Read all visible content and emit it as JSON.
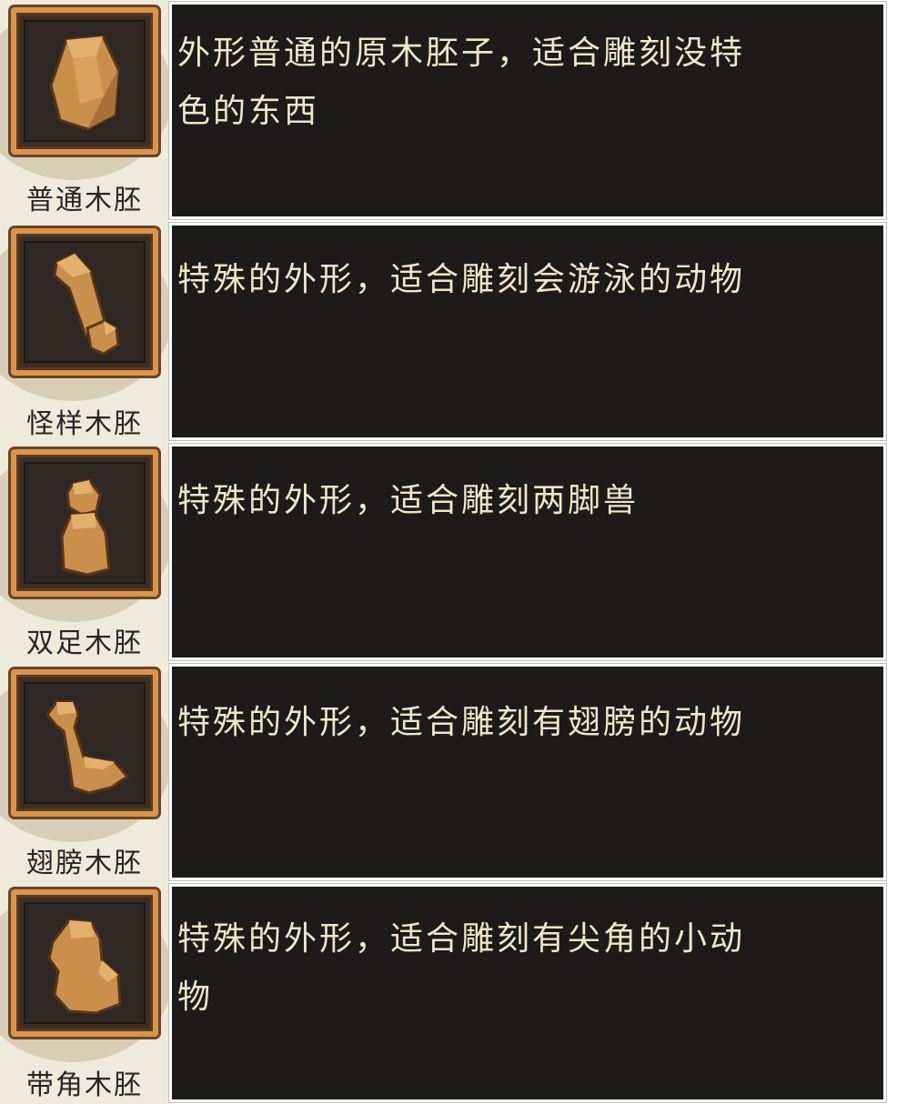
{
  "items": [
    {
      "name": "普通木胚",
      "description": "外形普通的原木胚子，适合雕刻没特\n色的东西",
      "icon": "plain-wood-blank-icon"
    },
    {
      "name": "怪样木胚",
      "description": "特殊的外形，适合雕刻会游泳的动物",
      "icon": "odd-wood-blank-icon"
    },
    {
      "name": "双足木胚",
      "description": "特殊的外形，适合雕刻两脚兽",
      "icon": "biped-wood-blank-icon"
    },
    {
      "name": "翅膀木胚",
      "description": "特殊的外形，适合雕刻有翅膀的动物",
      "icon": "wing-wood-blank-icon"
    },
    {
      "name": "带角木胚",
      "description": "特殊的外形，适合雕刻有尖角的小动\n物",
      "icon": "horned-wood-blank-icon"
    }
  ],
  "colors": {
    "wood": "#c98f4c",
    "wood_light": "#e3b06e",
    "wood_dark": "#8a5a2b",
    "frame": "#d9954e",
    "panel_bg": "#1c1b19",
    "text": "#efe6c8"
  }
}
